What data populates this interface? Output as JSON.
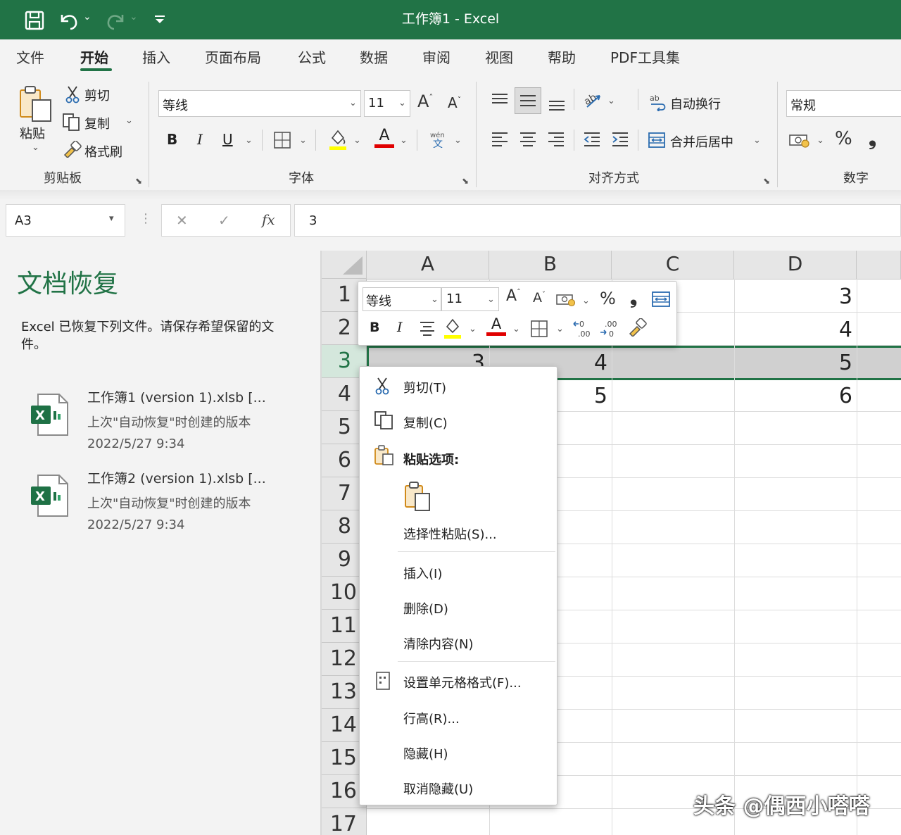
{
  "title_bar": {
    "title": "工作簿1  -  Excel"
  },
  "tabs": [
    {
      "label": "文件"
    },
    {
      "label": "开始"
    },
    {
      "label": "插入"
    },
    {
      "label": "页面布局"
    },
    {
      "label": "公式"
    },
    {
      "label": "数据"
    },
    {
      "label": "审阅"
    },
    {
      "label": "视图"
    },
    {
      "label": "帮助"
    },
    {
      "label": "PDF工具集"
    }
  ],
  "ribbon": {
    "clipboard": {
      "paste": "粘贴",
      "cut": "剪切",
      "copy": "复制",
      "format_painter": "格式刷",
      "group": "剪贴板"
    },
    "font": {
      "font_name": "等线",
      "font_size": "11",
      "bold": "B",
      "italic": "I",
      "underline": "U",
      "font_color": "A",
      "group": "字体"
    },
    "alignment": {
      "wrap_text": "自动换行",
      "merge_center": "合并后居中",
      "group": "对齐方式"
    },
    "number": {
      "format": "常规",
      "percent": "%",
      "comma": "❟",
      "group": "数字"
    }
  },
  "formula_bar": {
    "name_box": "A3",
    "cancel": "✕",
    "enter": "✓",
    "fx": "fx",
    "value": "3"
  },
  "recovery": {
    "title": "文档恢复",
    "message": "Excel 已恢复下列文件。请保存希望保留的文件。",
    "files": [
      {
        "name": "工作簿1 (version 1).xlsb   [...",
        "desc": "上次\"自动恢复\"时创建的版本",
        "time": "2022/5/27 9:34"
      },
      {
        "name": "工作簿2 (version 1).xlsb   [...",
        "desc": "上次\"自动恢复\"时创建的版本",
        "time": "2022/5/27 9:34"
      }
    ]
  },
  "grid": {
    "columns": [
      "A",
      "B",
      "C",
      "D"
    ],
    "rows": [
      "1",
      "2",
      "3",
      "4",
      "5",
      "6",
      "7",
      "8",
      "9",
      "10",
      "11",
      "12",
      "13",
      "14",
      "15",
      "16",
      "17"
    ],
    "cells": {
      "D1": "3",
      "D2": "4",
      "A3": "3",
      "B3": "4",
      "D3": "5",
      "B4": "5",
      "D4": "6"
    }
  },
  "mini_toolbar": {
    "font_name": "等线",
    "font_size": "11",
    "bold": "B",
    "italic": "I",
    "percent": "%",
    "comma": "❟",
    "font_color": "A"
  },
  "context_menu": {
    "cut": "剪切(T)",
    "copy": "复制(C)",
    "paste_options": "粘贴选项:",
    "paste_special": "选择性粘贴(S)...",
    "insert": "插入(I)",
    "delete": "删除(D)",
    "clear": "清除内容(N)",
    "format_cells": "设置单元格格式(F)...",
    "row_height": "行高(R)...",
    "hide": "隐藏(H)",
    "unhide": "取消隐藏(U)"
  },
  "watermark": "头条 @偶西小嗒嗒",
  "colors": {
    "accent": "#217346",
    "selected_row": "#d4e7dc"
  }
}
